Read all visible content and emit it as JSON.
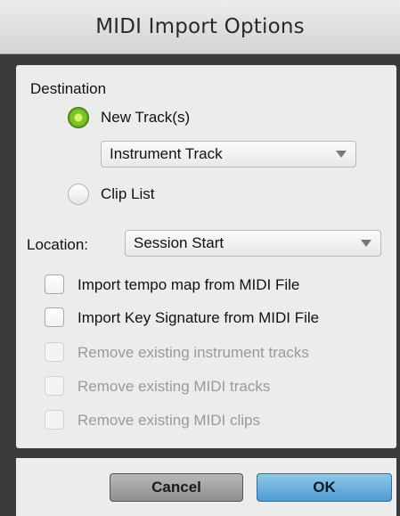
{
  "dialog": {
    "title": "MIDI Import Options"
  },
  "destination": {
    "heading": "Destination",
    "new_tracks_label": "New Track(s)",
    "new_tracks_selected": true,
    "track_type_value": "Instrument Track",
    "clip_list_label": "Clip List",
    "clip_list_selected": false
  },
  "location": {
    "label": "Location:",
    "value": "Session Start"
  },
  "options": {
    "import_tempo_label": "Import tempo map from MIDI File",
    "import_key_label": "Import Key Signature from MIDI File",
    "remove_instrument_label": "Remove existing instrument tracks",
    "remove_midi_tracks_label": "Remove existing MIDI tracks",
    "remove_midi_clips_label": "Remove existing MIDI clips"
  },
  "buttons": {
    "cancel_label": "Cancel",
    "ok_label": "OK"
  },
  "colors": {
    "radio_on": "#7cc32c",
    "ok_button": "#4f9bd2",
    "disabled_text": "#9a9a9a"
  }
}
